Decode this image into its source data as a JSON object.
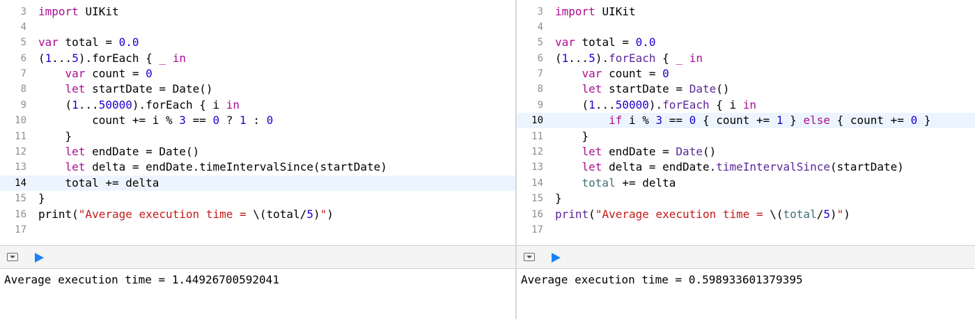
{
  "left": {
    "output": "Average execution time = 1.44926700592041",
    "lines": [
      {
        "num": "3"
      },
      {
        "num": "4"
      },
      {
        "num": "5"
      },
      {
        "num": "6"
      },
      {
        "num": "7"
      },
      {
        "num": "8"
      },
      {
        "num": "9"
      },
      {
        "num": "10"
      },
      {
        "num": "11"
      },
      {
        "num": "12"
      },
      {
        "num": "13"
      },
      {
        "num": "14",
        "highlighted": true
      },
      {
        "num": "15"
      },
      {
        "num": "16"
      },
      {
        "num": "17"
      }
    ],
    "t": {
      "l3_import": "import",
      "l3_mod": "UIKit",
      "l5_var": "var",
      "l5_name": "total =",
      "l5_val": "0.0",
      "l6_open": "(",
      "l6_a": "1",
      "l6_range": "...",
      "l6_b": "5",
      "l6_call": ").forEach { ",
      "l6_us": "_",
      "l6_in": "in",
      "l7_var": "var",
      "l7_name": "count =",
      "l7_val": "0",
      "l8_let": "let",
      "l8_rest": "startDate = Date()",
      "l9_open": "(",
      "l9_a": "1",
      "l9_range": "...",
      "l9_b": "50000",
      "l9_call": ").forEach { i ",
      "l9_in": "in",
      "l10_a": "count += i % ",
      "l10_b": "3",
      "l10_c": "==",
      "l10_d": "0",
      "l10_e": "?",
      "l10_f": "1",
      "l10_g": ":",
      "l10_h": "0",
      "l11": "}",
      "l12_let": "let",
      "l12_rest": "endDate = Date()",
      "l13_let": "let",
      "l13_rest": "delta = endDate.timeIntervalSince(startDate)",
      "l14": "total += delta",
      "l15": "}",
      "l16_a": "print(",
      "l16_str1": "\"Average execution time = ",
      "l16_interp": "\\(total/",
      "l16_num": "5",
      "l16_close": ")",
      "l16_str2": "\"",
      "l16_end": ")"
    }
  },
  "right": {
    "output": "Average execution time = 0.598933601379395",
    "lines": [
      {
        "num": "3"
      },
      {
        "num": "4"
      },
      {
        "num": "5"
      },
      {
        "num": "6"
      },
      {
        "num": "7"
      },
      {
        "num": "8"
      },
      {
        "num": "9"
      },
      {
        "num": "10",
        "highlighted": true
      },
      {
        "num": "11"
      },
      {
        "num": "12"
      },
      {
        "num": "13"
      },
      {
        "num": "14"
      },
      {
        "num": "15"
      },
      {
        "num": "16"
      },
      {
        "num": "17"
      }
    ],
    "t": {
      "l3_import": "import",
      "l3_mod": "UIKit",
      "l5_var": "var",
      "l5_name": "total =",
      "l5_val": "0.0",
      "l6_open": "(",
      "l6_a": "1",
      "l6_range": "...",
      "l6_b": "5",
      "l6_call": ").",
      "l6_fe": "forEach",
      "l6_brace": " { ",
      "l6_us": "_",
      "l6_in": "in",
      "l7_var": "var",
      "l7_name": "count =",
      "l7_val": "0",
      "l8_let": "let",
      "l8_name": "startDate =",
      "l8_fn": "Date",
      "l8_parens": "()",
      "l9_open": "(",
      "l9_a": "1",
      "l9_range": "...",
      "l9_b": "50000",
      "l9_call": ").",
      "l9_fe": "forEach",
      "l9_rest": " { i ",
      "l9_in": "in",
      "l10_if": "if",
      "l10_a": " i % ",
      "l10_b": "3",
      "l10_c": " == ",
      "l10_d": "0",
      "l10_e": " { count += ",
      "l10_f": "1",
      "l10_g": " } ",
      "l10_else": "else",
      "l10_h": " { count += ",
      "l10_i": "0",
      "l10_j": " }",
      "l11": "}",
      "l12_let": "let",
      "l12_name": "endDate =",
      "l12_fn": "Date",
      "l12_parens": "()",
      "l13_let": "let",
      "l13_a": "delta = endDate.",
      "l13_fn": "timeIntervalSince",
      "l13_b": "(startDate)",
      "l14_var": "total",
      "l14_rest": " += delta",
      "l15": "}",
      "l16_fn": "print",
      "l16_open": "(",
      "l16_str1": "\"Average execution time = ",
      "l16_interp": "\\(",
      "l16_var": "total",
      "l16_slash": "/",
      "l16_num": "5",
      "l16_close": ")",
      "l16_str2": "\"",
      "l16_end": ")"
    }
  }
}
